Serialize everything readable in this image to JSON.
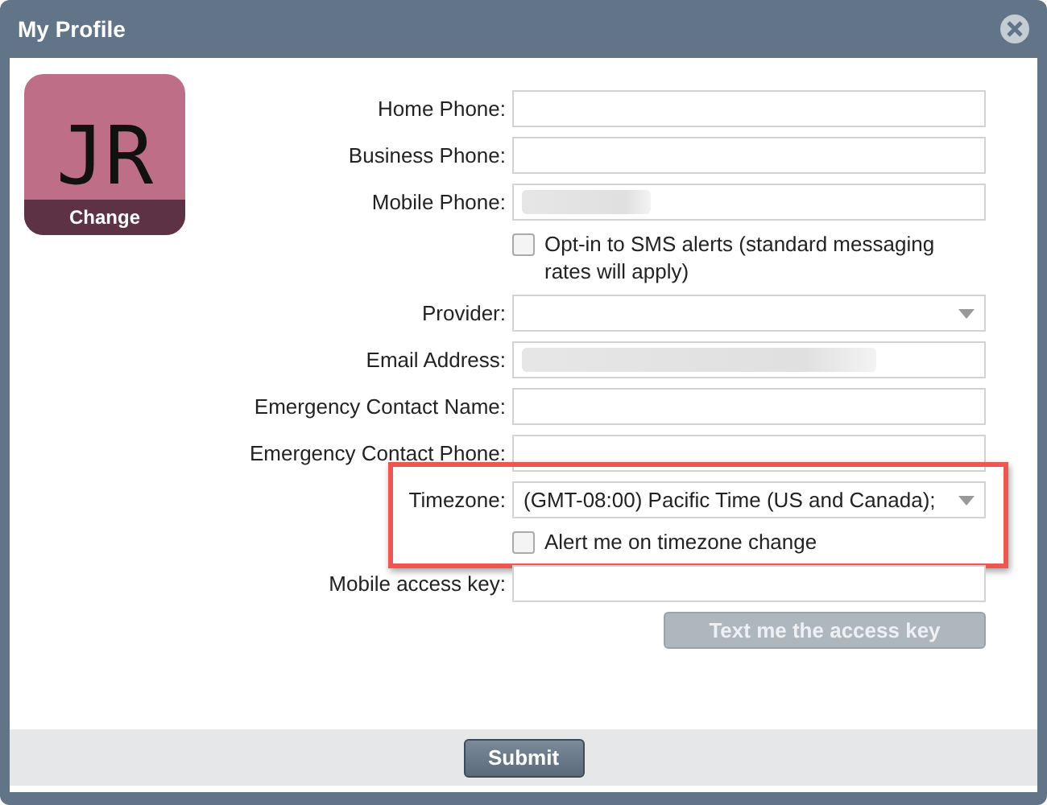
{
  "window": {
    "title": "My Profile"
  },
  "avatar": {
    "initials": "JR",
    "action": "Change"
  },
  "rows": [
    {
      "kind": "text",
      "label": "Home Phone:",
      "redacted": false
    },
    {
      "kind": "text",
      "label": "Business Phone:",
      "redacted": false
    },
    {
      "kind": "text",
      "label": "Mobile Phone:",
      "redacted": true
    },
    {
      "kind": "checkbox",
      "text": "Opt-in to SMS alerts (standard messaging rates will apply)",
      "checked": false
    },
    {
      "kind": "select",
      "label": "Provider:"
    },
    {
      "kind": "text",
      "label": "Email Address:",
      "redacted": true
    },
    {
      "kind": "text",
      "label": "Emergency Contact Name:",
      "redacted": false
    },
    {
      "kind": "text",
      "label": "Emergency Contact Phone:",
      "redacted": false
    },
    {
      "kind": "highlight",
      "rows": [
        {
          "kind": "select",
          "label": "Timezone:",
          "value": "(GMT-08:00) Pacific Time (US and Canada);"
        },
        {
          "kind": "checkbox",
          "text": "Alert me on timezone change",
          "checked": false
        }
      ]
    },
    {
      "kind": "text",
      "label": "Mobile access key:",
      "redacted": false
    },
    {
      "kind": "button",
      "text": "Text me the access key",
      "disabled": true
    }
  ],
  "submit": "Submit"
}
